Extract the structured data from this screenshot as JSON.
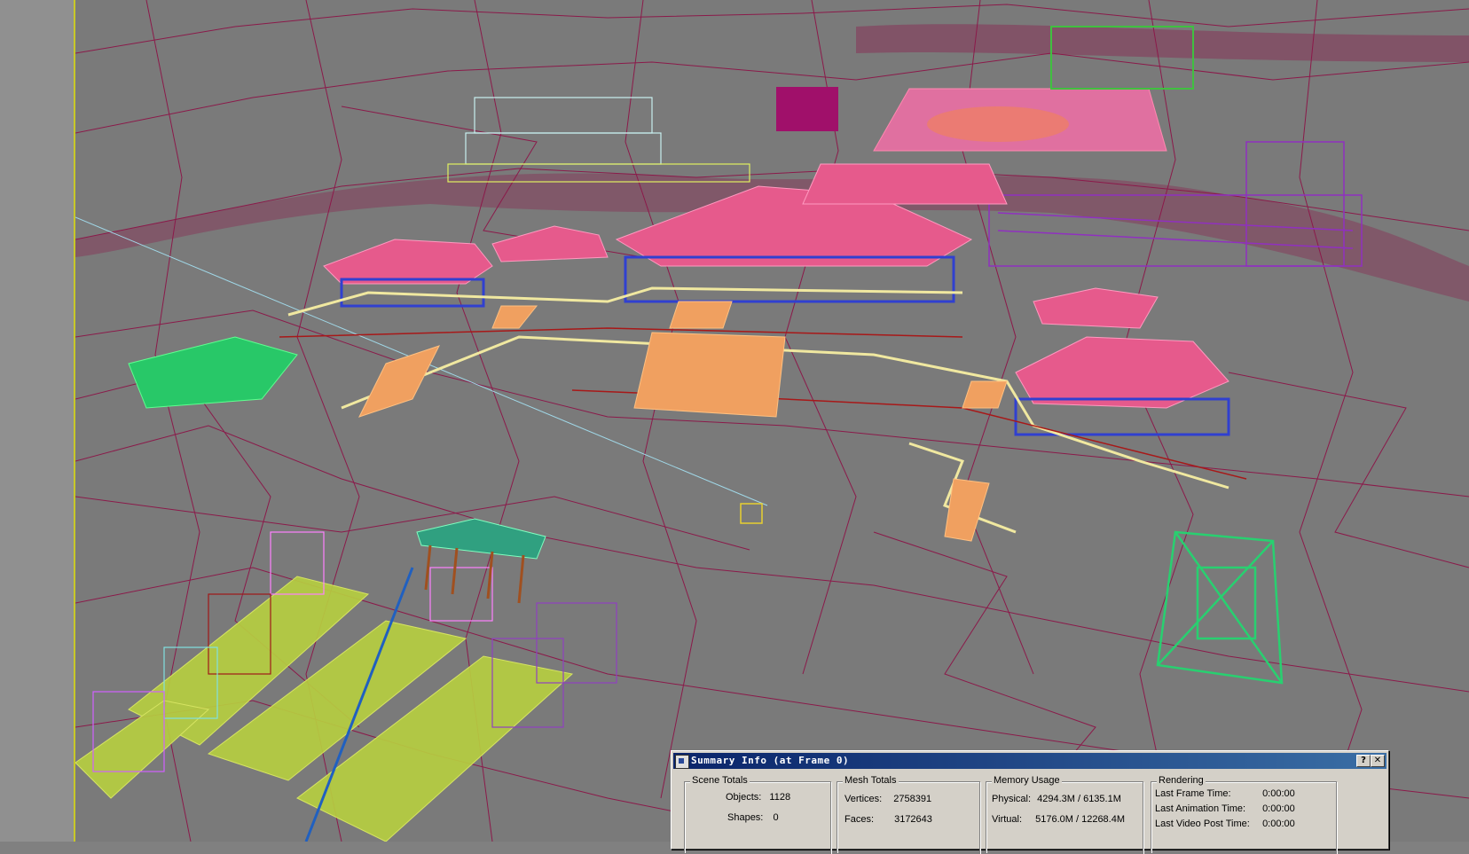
{
  "dialog": {
    "title": "Summary Info (at Frame 0)",
    "help_label": "?",
    "close_label": "✕",
    "scene_totals": {
      "title": "Scene Totals",
      "objects_label": "Objects:",
      "objects_value": "1128",
      "shapes_label": "Shapes:",
      "shapes_value": "0"
    },
    "mesh_totals": {
      "title": "Mesh Totals",
      "vertices_label": "Vertices:",
      "vertices_value": "2758391",
      "faces_label": "Faces:",
      "faces_value": "3172643"
    },
    "memory_usage": {
      "title": "Memory Usage",
      "physical_label": "Physical:",
      "physical_value": "4294.3M / 6135.1M",
      "virtual_label": "Virtual:",
      "virtual_value": "5176.0M / 12268.4M"
    },
    "rendering": {
      "title": "Rendering",
      "last_frame_label": "Last Frame Time:",
      "last_frame_value": "0:00:00",
      "last_animation_label": "Last Animation Time:",
      "last_animation_value": "0:00:00",
      "last_video_post_label": "Last Video Post Time:",
      "last_video_post_value": "0:00:00"
    }
  },
  "colors": {
    "viewport_bg": "#7a7a7a",
    "terrain_wire": "#8b1a4a",
    "roof_pink": "#e8608a",
    "steps_orange": "#f0a060",
    "wall_cream": "#f0e8a0",
    "tree_green": "#2ad070",
    "lawn_yellow": "#b8d040",
    "titlebar": "#0a246a"
  }
}
